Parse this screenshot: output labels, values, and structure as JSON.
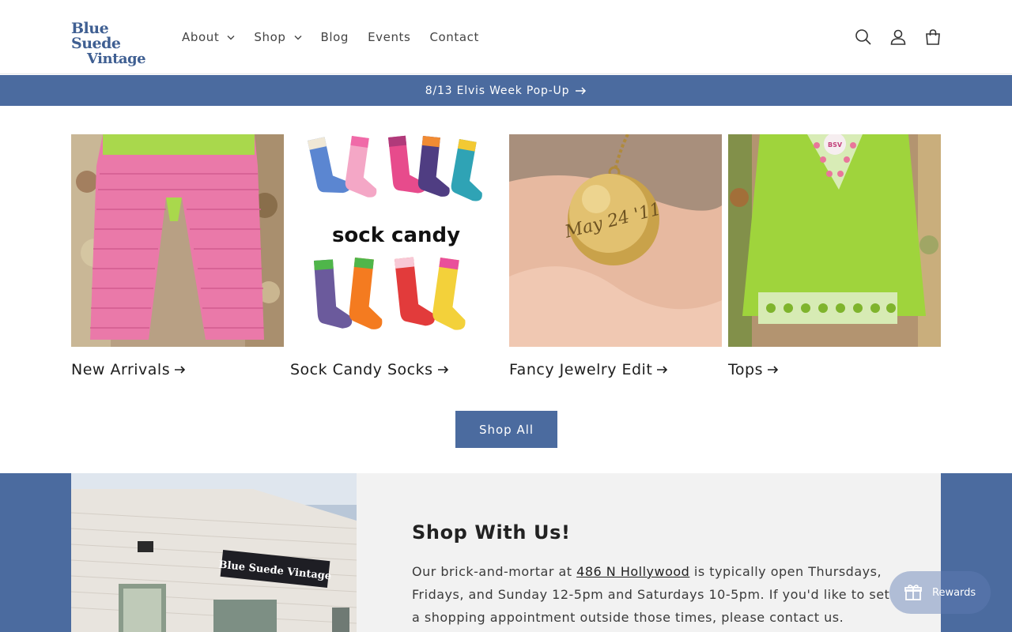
{
  "brand": {
    "logo_line1": "Blue Suede",
    "logo_line2": "Vintage",
    "accent": "#4b6b9f"
  },
  "nav": {
    "items": [
      {
        "label": "About",
        "dropdown": true
      },
      {
        "label": "Shop",
        "dropdown": true
      },
      {
        "label": "Blog",
        "dropdown": false
      },
      {
        "label": "Events",
        "dropdown": false
      },
      {
        "label": "Contact",
        "dropdown": false
      }
    ],
    "icons": [
      "search-icon",
      "account-icon",
      "cart-icon"
    ]
  },
  "announcement": {
    "text": "8/13 Elvis Week Pop-Up"
  },
  "collections": [
    {
      "title": "New Arrivals"
    },
    {
      "title": "Sock Candy Socks",
      "image_text": "sock candy"
    },
    {
      "title": "Fancy Jewelry Edit",
      "image_text": "May 24 '11"
    },
    {
      "title": "Tops",
      "image_text": "BSV"
    }
  ],
  "shop_all": {
    "label": "Shop All"
  },
  "store": {
    "sign_text": "Blue Suede Vintage",
    "title": "Shop With Us!",
    "text_before": "Our brick-and-mortar at ",
    "link_text": "486 N Hollywood",
    "text_after": " is typically open Thursdays, Fridays, and Sunday 12-5pm and Saturdays 10-5pm. If you'd like to set a shopping appointment outside those times, please contact us."
  },
  "rewards": {
    "label": "Rewards"
  }
}
